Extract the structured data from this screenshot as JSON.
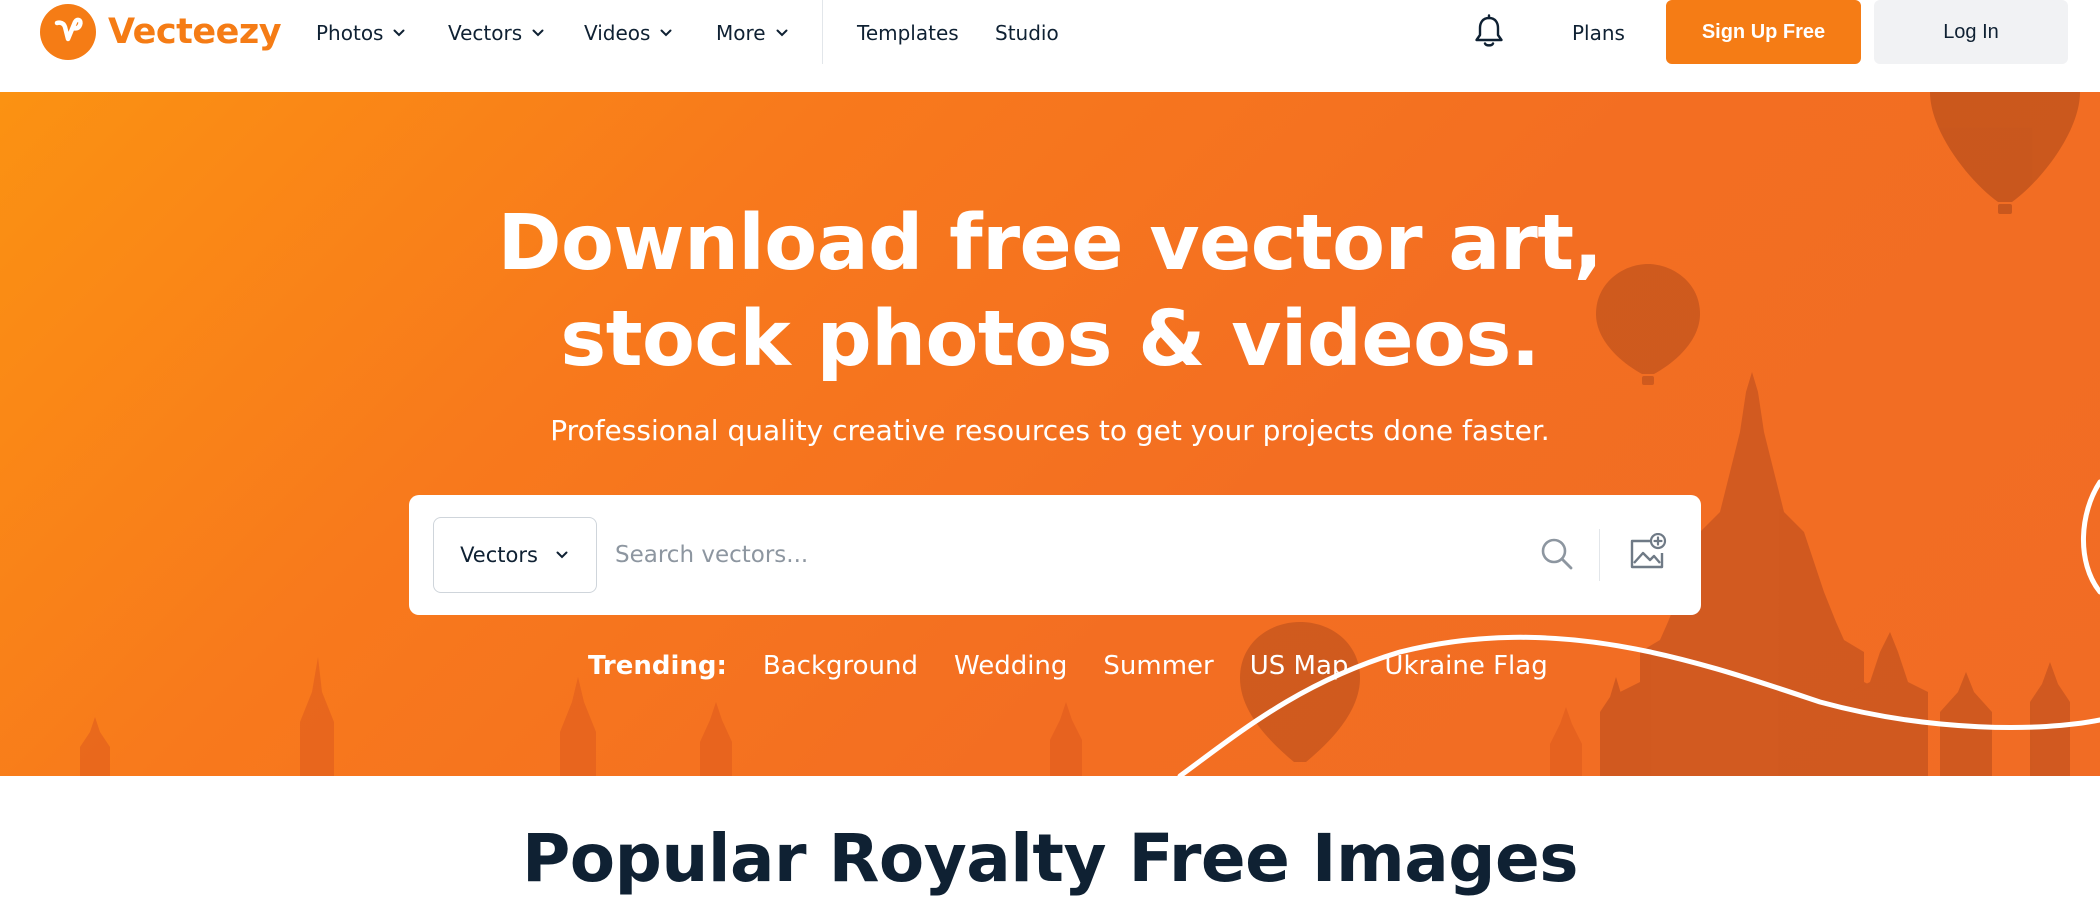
{
  "brand": {
    "name": "Vecteezy",
    "accent_color": "#f57c15",
    "logo_icon": "vecteezy-v-icon"
  },
  "nav": {
    "items": [
      {
        "label": "Photos",
        "has_dropdown": true
      },
      {
        "label": "Vectors",
        "has_dropdown": true
      },
      {
        "label": "Videos",
        "has_dropdown": true
      },
      {
        "label": "More",
        "has_dropdown": true
      },
      {
        "label": "Templates",
        "has_dropdown": false
      },
      {
        "label": "Studio",
        "has_dropdown": false
      }
    ],
    "notifications_icon": "bell-icon",
    "plans_label": "Plans",
    "signup_label": "Sign Up Free",
    "login_label": "Log In"
  },
  "hero": {
    "title_line1": "Download free vector art,",
    "title_line2": "stock photos & videos.",
    "subtitle": "Professional quality creative resources to get your projects done faster.",
    "search": {
      "asset_type": "Vectors",
      "placeholder": "Search vectors...",
      "value": "",
      "search_icon": "search-icon",
      "image_search_icon": "image-search-icon"
    },
    "trending": {
      "label": "Trending:",
      "terms": [
        "Background",
        "Wedding",
        "Summer",
        "US Map",
        "Ukraine Flag"
      ]
    }
  },
  "section": {
    "title": "Popular Royalty Free Images"
  }
}
